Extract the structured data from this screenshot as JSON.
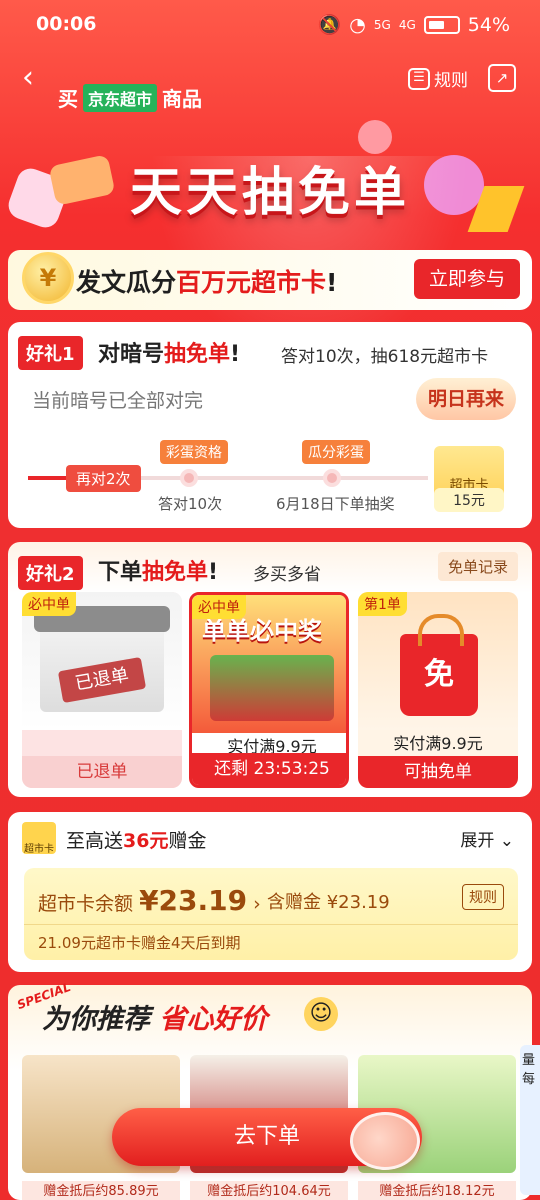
{
  "status_bar": {
    "time": "00:06",
    "battery": "54%",
    "signal1": "5G",
    "signal2": "4G"
  },
  "header": {
    "back": "‹",
    "buy_prefix": "买",
    "jd_tag": "京东超市",
    "buy_suffix": "商品",
    "rules": "规则"
  },
  "banner": {
    "title": "天天抽免单"
  },
  "promo": {
    "text_a": "发文瓜分",
    "text_b": "百万元超市卡",
    "text_c": "!",
    "button": "立即参与",
    "coin": "¥"
  },
  "gift1": {
    "tag": "好礼1",
    "title_a": "对暗号",
    "title_b": "抽免单",
    "title_c": "!",
    "subtitle": "答对10次，抽618元超市卡",
    "status": "当前暗号已全部对完",
    "button": "明日再来",
    "progress_pill": "再对2次",
    "nodes": [
      {
        "label": "彩蛋资格",
        "text": "答对10次"
      },
      {
        "label": "瓜分彩蛋",
        "text": "6月18日下单抽奖"
      }
    ],
    "card": {
      "label": "超市卡",
      "amount": "15元"
    }
  },
  "gift2": {
    "tag": "好礼2",
    "title_a": "下单",
    "title_b": "抽免单",
    "title_c": "!",
    "subtitle": "多买多省",
    "records": "免单记录",
    "products": [
      {
        "badge": "必中单",
        "stamp": "已退单",
        "price": "",
        "footer": "已退单"
      },
      {
        "badge": "必中单",
        "banner": "单单必中奖",
        "price": "实付满9.9元",
        "footer": "还剩 23:53:25"
      },
      {
        "badge": "第1单",
        "bag": "免",
        "price": "实付满9.9元",
        "footer": "可抽免单"
      }
    ]
  },
  "wallet": {
    "icon": "超市卡",
    "title_a": "至高送",
    "title_b": "36元",
    "title_c": "赠金",
    "expand": "展开",
    "balance_label": "超市卡余额",
    "balance": "¥23.19",
    "gift_label": "含赠金 ¥23.19",
    "rules": "规则",
    "expire": "21.09元超市卡赠金4天后到期"
  },
  "recommend": {
    "special": "SPECIAL",
    "title_a": "为你推荐",
    "title_b": "省心好价",
    "items": [
      {
        "price": "赠金抵后约85.89元"
      },
      {
        "price": "赠金抵后约104.64元"
      },
      {
        "price": "赠金抵后约18.12元"
      }
    ],
    "side": "量每"
  },
  "cta": {
    "label": "去下单"
  },
  "colors": {
    "primary": "#e9262a",
    "jd_green": "#26b25a",
    "gold": "#ffd44d"
  }
}
